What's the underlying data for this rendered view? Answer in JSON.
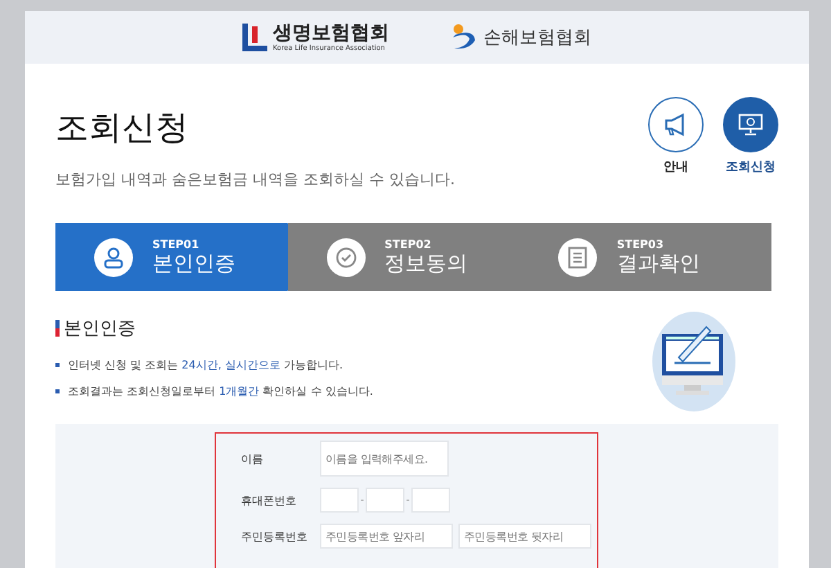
{
  "header": {
    "logos": [
      {
        "kind": "life",
        "name": "생명보험협회",
        "subtitle": "Korea Life Insurance Association"
      },
      {
        "kind": "nonlife",
        "name": "손해보험협회"
      }
    ]
  },
  "page": {
    "title": "조회신청",
    "description": "보험가입 내역과 숨은보험금 내역을 조회하실 수 있습니다."
  },
  "quick_links": [
    {
      "kind": "guide",
      "label": "안내",
      "selected": false
    },
    {
      "kind": "inquiry",
      "label": "조회신청",
      "selected": true
    }
  ],
  "steps": [
    {
      "kind": "person",
      "step": "STEP01",
      "label": "본인인증",
      "selected": true
    },
    {
      "kind": "check",
      "step": "STEP02",
      "label": "정보동의",
      "selected": false
    },
    {
      "kind": "document",
      "step": "STEP03",
      "label": "결과확인",
      "selected": false
    }
  ],
  "section": {
    "title": "본인인증",
    "bullets": [
      "인터넷 신청 및 조회는 **24시간, 실시간으로** 가능합니다.",
      "조회결과는 조회신청일로부터 **1개월간** 확인하실 수 있습니다."
    ]
  },
  "form": {
    "fields": [
      {
        "kind": "text",
        "label": "이름",
        "placeholder": "이름을 입력해주세요."
      },
      {
        "kind": "phone",
        "label": "휴대폰번호",
        "separator": "-"
      },
      {
        "kind": "split",
        "label": "주민등록번호",
        "placeholders": [
          "주민등록번호 앞자리",
          "주민등록번호 뒷자리"
        ]
      }
    ]
  }
}
